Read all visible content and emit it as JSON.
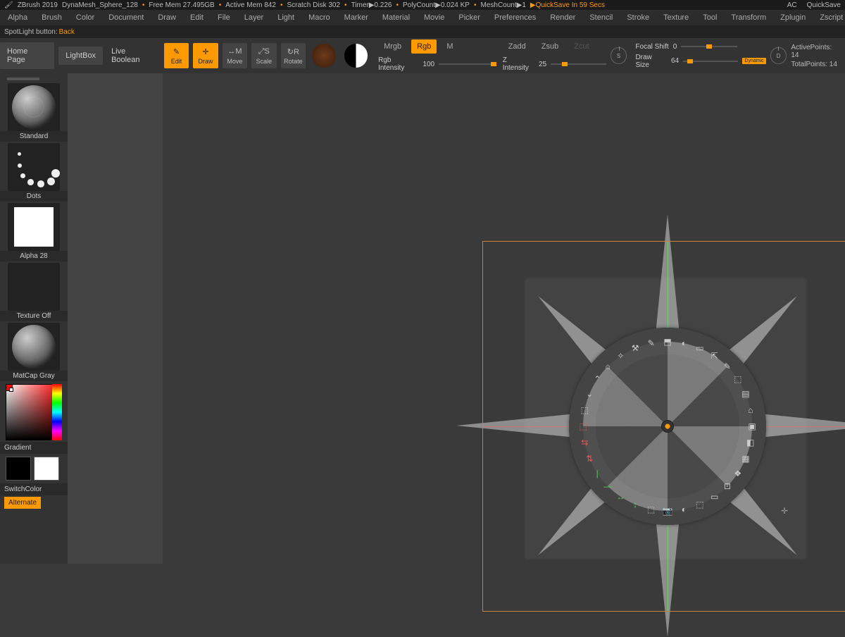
{
  "title": {
    "app": "ZBrush 2019",
    "project": "DynaMesh_Sphere_128",
    "free_mem": "Free Mem 27.495GB",
    "active_mem": "Active Mem 842",
    "scratch": "Scratch Disk 302",
    "timer": "Timer▶0.226",
    "poly": "PolyCount▶0.024 KP",
    "mesh": "MeshCount▶1",
    "quicksave_msg": "▶QuickSave In 59 Secs",
    "ac": "AC",
    "quicksave": "QuickSave"
  },
  "menu": [
    "Alpha",
    "Brush",
    "Color",
    "Document",
    "Draw",
    "Edit",
    "File",
    "Layer",
    "Light",
    "Macro",
    "Marker",
    "Material",
    "Movie",
    "Picker",
    "Preferences",
    "Render",
    "Stencil",
    "Stroke",
    "Texture",
    "Tool",
    "Transform",
    "Zplugin",
    "Zscript"
  ],
  "tooltip": {
    "label": "SpotLight button:",
    "value": "Back"
  },
  "shelf": {
    "home": "Home Page",
    "lightbox": "LightBox",
    "livebool": "Live Boolean",
    "gizmos": {
      "edit": "Edit",
      "draw": "Draw",
      "move": "Move",
      "scale": "Scale",
      "rotate": "Rotate"
    },
    "mrgb": "Mrgb",
    "rgb": "Rgb",
    "m": "M",
    "rgb_int": "Rgb Intensity",
    "rgb_int_v": "100",
    "zadd": "Zadd",
    "zsub": "Zsub",
    "zcut": "Zcut",
    "zint": "Z Intensity",
    "zint_v": "25",
    "s": "S",
    "focal": "Focal Shift",
    "focal_v": "0",
    "drawsize": "Draw Size",
    "drawsize_v": "64",
    "dynamic": "Dynamic",
    "d": "D",
    "active_pts": "ActivePoints: 14",
    "total_pts": "TotalPoints: 14"
  },
  "side": {
    "brush": "Standard",
    "stroke": "Dots",
    "alpha": "Alpha 28",
    "tex": "Texture Off",
    "mat": "MatCap Gray",
    "gradient": "Gradient",
    "switch": "SwitchColor",
    "alt": "Alternate"
  },
  "ring_icons": [
    "⬒",
    "◐",
    "▭",
    "⇱",
    "✎",
    "⬚",
    "▤",
    "⌂",
    "▣",
    "◧",
    "▦",
    "❖",
    "⊡",
    "▭",
    "⬚",
    "◐",
    "📷",
    "⬚",
    "↕",
    "↔",
    "—",
    "|",
    "⇅",
    "⇆",
    "⬚",
    "⬚",
    "⌄",
    "⌃",
    "⌂",
    "✧",
    "⚒",
    "✎"
  ]
}
